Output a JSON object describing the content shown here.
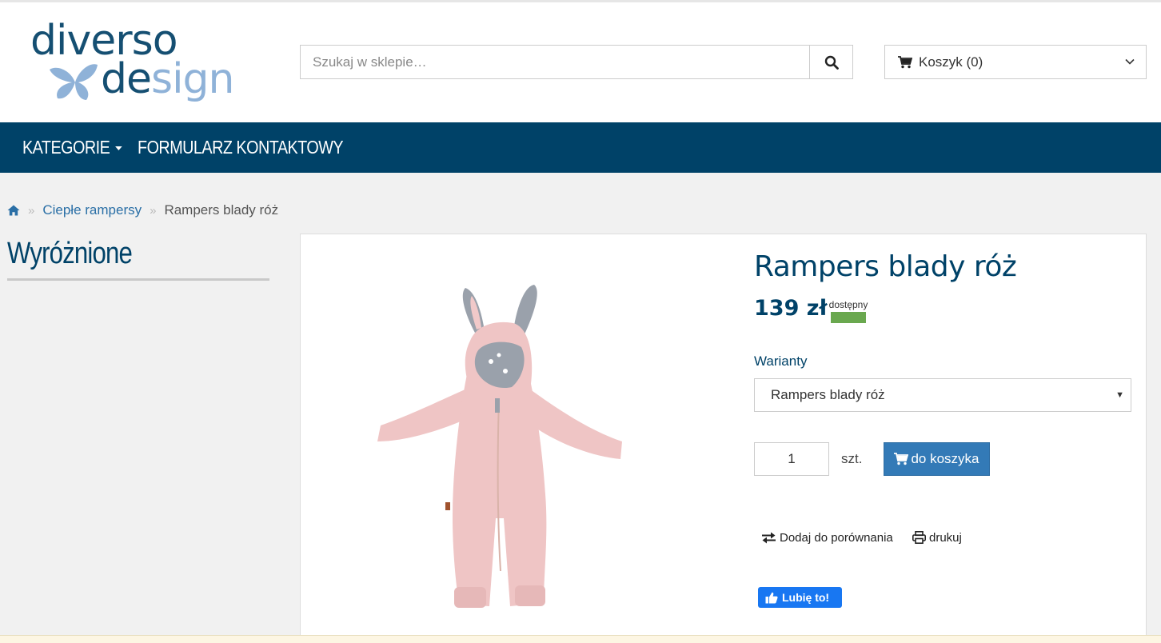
{
  "header": {
    "logo": {
      "line1": "diverso",
      "line2_a": "de",
      "line2_b": "sign"
    },
    "search": {
      "placeholder": "Szukaj w sklepie…",
      "value": ""
    },
    "cart": {
      "label": "Koszyk (0)"
    }
  },
  "nav": {
    "items": [
      {
        "label": "KATEGORIE",
        "dropdown": true
      },
      {
        "label": "FORMULARZ KONTAKTOWY",
        "dropdown": false
      }
    ]
  },
  "breadcrumb": {
    "home_icon": "home-icon",
    "items": [
      {
        "label": "Ciepłe rampersy"
      },
      {
        "label": "Rampers blady róż"
      }
    ],
    "separator": "»"
  },
  "sidebar": {
    "title": "Wyróżnione"
  },
  "product": {
    "title": "Rampers blady róż",
    "price": "139 zł",
    "availability": "dostępny",
    "availability_color": "#6aa84f",
    "variants_label": "Warianty",
    "variant_selected": "Rampers blady róż",
    "quantity": "1",
    "unit": "szt.",
    "add_to_cart": "do koszyka",
    "compare": "Dodaj do porównania",
    "print": "drukuj",
    "fb_like": "Lubię to!"
  },
  "colors": {
    "brand_navy": "#004268",
    "link": "#2a6fa6",
    "button_primary": "#337ab7",
    "facebook": "#1877f2",
    "logo_light": "#8fb2d8"
  }
}
